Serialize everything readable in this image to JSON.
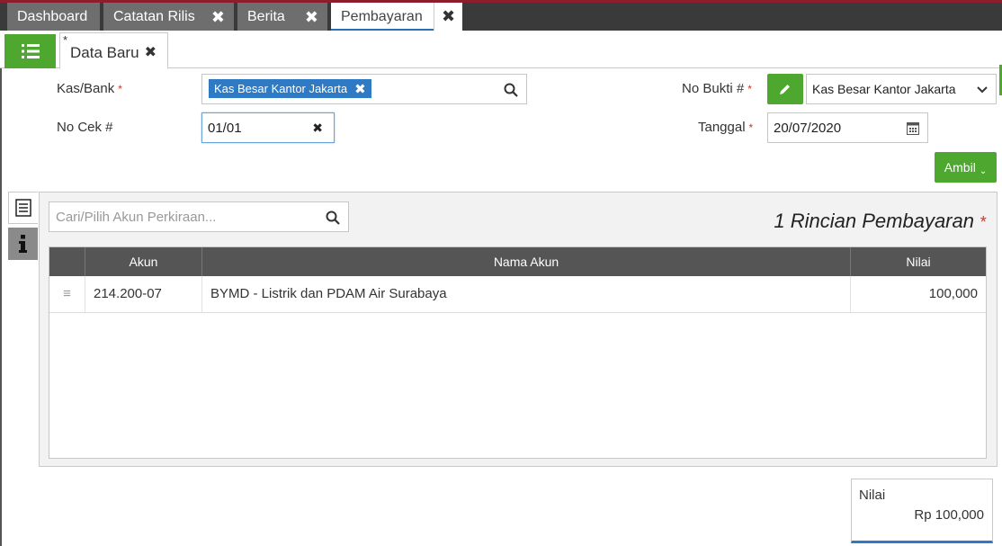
{
  "tabs": [
    {
      "label": "Dashboard",
      "closable": false
    },
    {
      "label": "Catatan Rilis",
      "closable": true
    },
    {
      "label": "Berita",
      "closable": true
    },
    {
      "label": "Pembayaran",
      "closable": true,
      "active": true
    }
  ],
  "subtab": {
    "modified_marker": "*",
    "label": "Data Baru"
  },
  "form": {
    "kas_bank": {
      "label": "Kas/Bank",
      "required": "*",
      "chip": "Kas Besar Kantor Jakarta"
    },
    "no_cek": {
      "label": "No Cek #",
      "value": "01/01"
    },
    "no_bukti": {
      "label": "No Bukti #",
      "required": "*",
      "select_value": "Kas Besar Kantor Jakarta"
    },
    "tanggal": {
      "label": "Tanggal",
      "required": "*",
      "value": "20/07/2020"
    },
    "ambil_label": "Ambil"
  },
  "detail": {
    "search_placeholder": "Cari/Pilih Akun Perkiraan...",
    "title": "1 Rincian Pembayaran",
    "required": "*",
    "columns": [
      "Akun",
      "Nama Akun",
      "Nilai"
    ],
    "rows": [
      {
        "akun": "214.200-07",
        "nama": "BYMD - Listrik dan PDAM Air Surabaya",
        "nilai": "100,000"
      }
    ]
  },
  "total": {
    "label": "Nilai",
    "value": "Rp 100,000"
  },
  "colors": {
    "accent_green": "#4ea72e",
    "accent_blue": "#2f7ac4",
    "required_red": "#c0392b"
  }
}
